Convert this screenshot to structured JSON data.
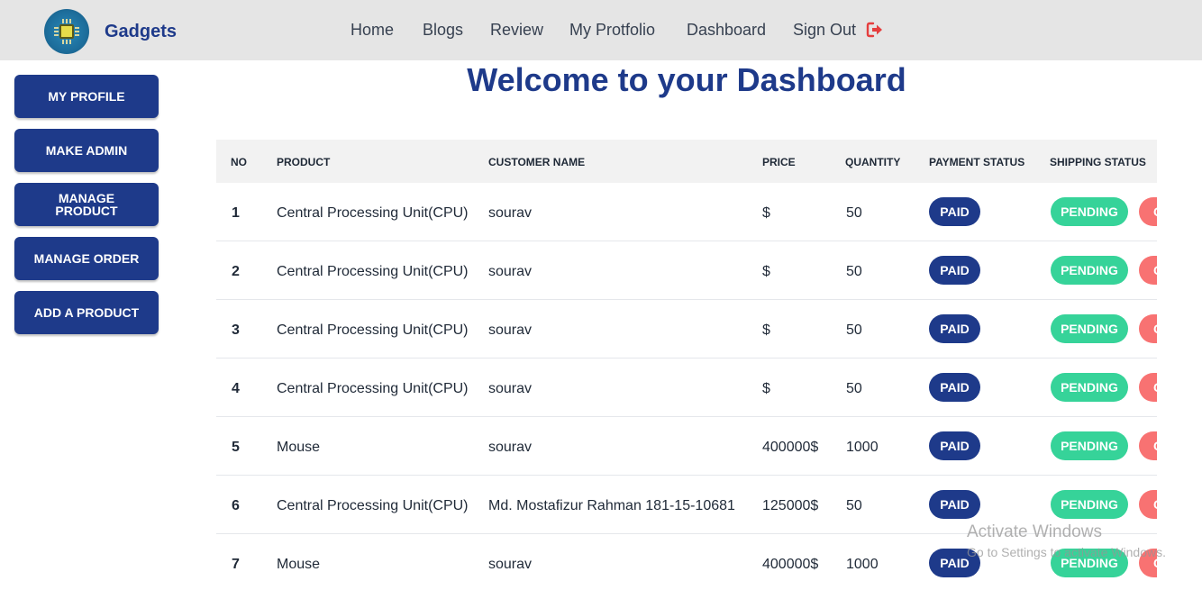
{
  "navbar": {
    "brand": "Gadgets",
    "links": [
      "Home",
      "Blogs",
      "Review",
      "My Protfolio",
      "Dashboard",
      "Sign Out"
    ]
  },
  "sidebar": {
    "buttons": [
      "MY PROFILE",
      "MAKE ADMIN",
      "MANAGE PRODUCT",
      "MANAGE ORDER",
      "ADD A PRODUCT"
    ]
  },
  "main": {
    "title": "Welcome to your Dashboard"
  },
  "table": {
    "headers": [
      "NO",
      "PRODUCT",
      "CUSTOMER NAME",
      "PRICE",
      "QUANTITY",
      "PAYMENT STATUS",
      "SHIPPING STATUS"
    ],
    "rows": [
      {
        "no": "1",
        "product": "Central Processing Unit(CPU)",
        "customer": "sourav",
        "price": "$",
        "quantity": "50",
        "payment": "PAID",
        "shipping": "PENDING",
        "action": "C"
      },
      {
        "no": "2",
        "product": "Central Processing Unit(CPU)",
        "customer": "sourav",
        "price": "$",
        "quantity": "50",
        "payment": "PAID",
        "shipping": "PENDING",
        "action": "C"
      },
      {
        "no": "3",
        "product": "Central Processing Unit(CPU)",
        "customer": "sourav",
        "price": "$",
        "quantity": "50",
        "payment": "PAID",
        "shipping": "PENDING",
        "action": "C"
      },
      {
        "no": "4",
        "product": "Central Processing Unit(CPU)",
        "customer": "sourav",
        "price": "$",
        "quantity": "50",
        "payment": "PAID",
        "shipping": "PENDING",
        "action": "C"
      },
      {
        "no": "5",
        "product": "Mouse",
        "customer": "sourav",
        "price": "400000$",
        "quantity": "1000",
        "payment": "PAID",
        "shipping": "PENDING",
        "action": "C"
      },
      {
        "no": "6",
        "product": "Central Processing Unit(CPU)",
        "customer": "Md. Mostafizur Rahman 181-15-10681",
        "price": "125000$",
        "quantity": "50",
        "payment": "PAID",
        "shipping": "PENDING",
        "action": "C"
      },
      {
        "no": "7",
        "product": "Mouse",
        "customer": "sourav",
        "price": "400000$",
        "quantity": "1000",
        "payment": "PAID",
        "shipping": "PENDING",
        "action": "C"
      }
    ]
  },
  "watermark": {
    "line1": "Activate Windows",
    "line2": "Go to Settings to activate Windows."
  },
  "colors": {
    "primary": "#1e3a8a",
    "pending": "#36d399",
    "cancel": "#f87272",
    "navbar_bg": "#e5e5e5",
    "signout_icon": "#e53e3e"
  },
  "icons": [
    "chip-logo-icon",
    "sign-out-icon"
  ]
}
